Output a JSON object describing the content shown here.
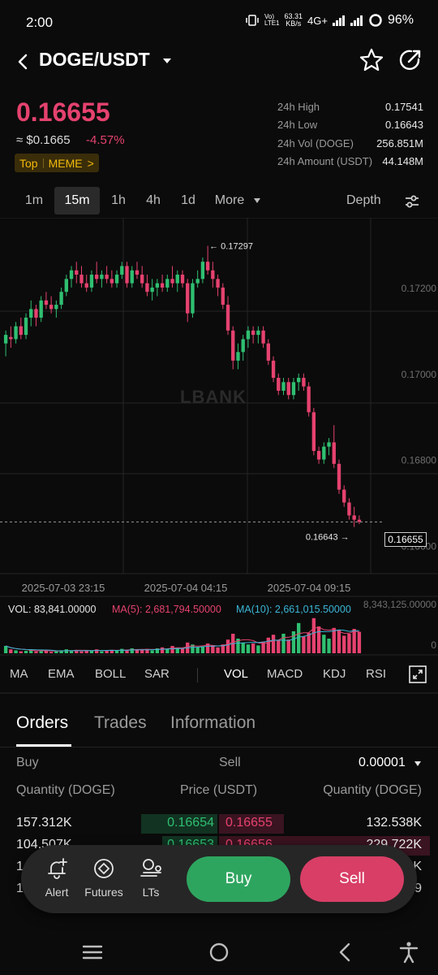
{
  "status": {
    "time": "2:00",
    "net_speed_value": "63.31",
    "net_speed_unit": "KB/s",
    "network": "4G+",
    "battery": "96%"
  },
  "header": {
    "pair": "DOGE/USDT"
  },
  "price": {
    "last": "0.16655",
    "fiat": "≈ $0.1665",
    "change": "-4.57%",
    "tag_top": "Top",
    "tag_meme": "MEME",
    "tag_arrow": ">"
  },
  "stats": [
    {
      "label": "24h High",
      "value": "0.17541"
    },
    {
      "label": "24h Low",
      "value": "0.16643"
    },
    {
      "label": "24h Vol (DOGE)",
      "value": "256.851M"
    },
    {
      "label": "24h Amount (USDT)",
      "value": "44.148M"
    }
  ],
  "timeframes": [
    "1m",
    "15m",
    "1h",
    "4h",
    "1d",
    "More"
  ],
  "active_timeframe": "15m",
  "depth_label": "Depth",
  "chart": {
    "watermark": "LBANK",
    "y_ticks": [
      "0.17200",
      "0.17000",
      "0.16800",
      "0.16600"
    ],
    "x_ticks": [
      "2025-07-03 23:15",
      "2025-07-04 04:15",
      "2025-07-04 09:15"
    ],
    "high_label": "0.17297",
    "low_label": "0.16643",
    "last_label": "0.16655",
    "vol_label": "VOL: 83,841.00000",
    "ma5_label": "MA(5): 2,681,794.50000",
    "ma10_label": "MA(10): 2,661,015.50000",
    "vol_max_label": "8,343,125.00000",
    "vol_zero_label": "0",
    "colors": {
      "up": "#2fbf71",
      "down": "#e5426f",
      "ma5": "#e5426f",
      "ma10": "#3bb6d6"
    }
  },
  "indicators": [
    "MA",
    "EMA",
    "BOLL",
    "SAR",
    "VOL",
    "MACD",
    "KDJ",
    "RSI"
  ],
  "active_indicator": "VOL",
  "tabs": [
    "Orders",
    "Trades",
    "Information"
  ],
  "active_tab": "Orders",
  "orderbook": {
    "buy_label": "Buy",
    "sell_label": "Sell",
    "precision": "0.00001",
    "col_qty_left": "Quantity (DOGE)",
    "col_price": "Price (USDT)",
    "col_qty_right": "Quantity (DOGE)",
    "rows": [
      {
        "bid_qty": "157.312K",
        "bid_price": "0.16654",
        "ask_price": "0.16655",
        "ask_qty": "132.538K"
      },
      {
        "bid_qty": "104.507K",
        "bid_price": "0.16653",
        "ask_price": "0.16656",
        "ask_qty": "229.722K"
      },
      {
        "bid_qty": "1",
        "bid_price": "",
        "ask_price": "",
        "ask_qty": "K"
      },
      {
        "bid_qty": "1",
        "bid_price": "",
        "ask_price": "",
        "ask_qty": "9"
      }
    ]
  },
  "actions": {
    "alert": "Alert",
    "futures": "Futures",
    "lts": "LTs",
    "buy": "Buy",
    "sell": "Sell"
  }
}
